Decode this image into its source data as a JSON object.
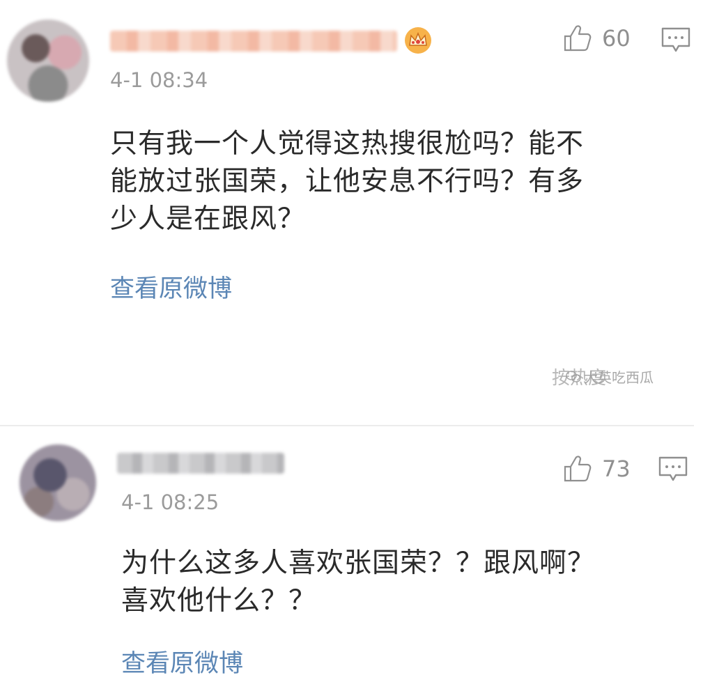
{
  "comments": [
    {
      "likes": "60",
      "time": "4-1 08:34",
      "content": "只有我一个人觉得这热搜很尬吗？能不\n能放过张国荣，让他安息不行吗？有多\n少人是在跟风？",
      "view_original": "查看原微博",
      "avatar_icon": "avatar-icon",
      "badge_icon": "crown-icon",
      "like_icon": "thumbs-up-icon",
      "reply_icon": "comment-icon"
    },
    {
      "likes": "73",
      "time": "4-1 08:25",
      "content": "为什么这多人喜欢张国荣？？跟风啊？\n喜欢他什么？？",
      "view_original": "查看原微博",
      "avatar_icon": "avatar-icon",
      "like_icon": "thumbs-up-icon",
      "reply_icon": "comment-icon"
    }
  ],
  "sort_label": "按热度",
  "watermark": "大英吃西瓜",
  "colors": {
    "link": "#5b86b5",
    "meta": "#9b9b9b",
    "text": "#2a2a2a",
    "divider": "#ececec"
  }
}
